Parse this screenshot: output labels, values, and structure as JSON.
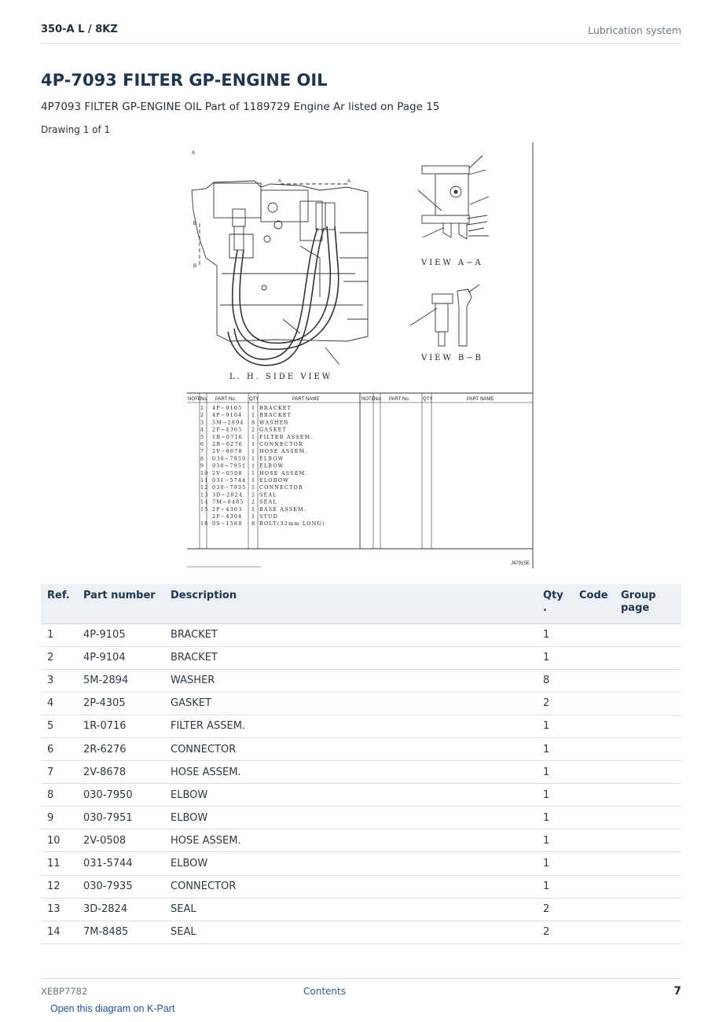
{
  "header": {
    "model": "350-A L  /  8KZ",
    "section": "Lubrication system"
  },
  "title": "4P-7093 FILTER GP-ENGINE OIL",
  "subtitle": "4P7093 FILTER GP-ENGINE OIL Part of 1189729 Engine Ar listed on Page 15",
  "drawing_count": "Drawing 1 of 1",
  "diagram": {
    "side_view_label": "L. H.   SIDE  VIEW",
    "view_a_label": "VIEW  A−A",
    "view_b_label": "VIEW  B−B",
    "marker_a": "A",
    "marker_b": "B",
    "drawing_code": "J47915E",
    "table_headers": {
      "note": "NOTE",
      "no": "No.",
      "part_no": "PART No.",
      "qty": "QTY",
      "part_name": "PART NAME"
    },
    "table_rows": [
      {
        "no": "1",
        "part": "4P−9105",
        "qty": "1",
        "name": "BRACKET"
      },
      {
        "no": "2",
        "part": "4P−9104",
        "qty": "1",
        "name": "BRACKET"
      },
      {
        "no": "3",
        "part": "5M−2894",
        "qty": "8",
        "name": "WASHER"
      },
      {
        "no": "4",
        "part": "2P−4305",
        "qty": "2",
        "name": "GASKET"
      },
      {
        "no": "5",
        "part": "1R−0716",
        "qty": "1",
        "name": "FILTER  ASSEM."
      },
      {
        "no": "6",
        "part": "2R−6276",
        "qty": "1",
        "name": "CONNECTOR"
      },
      {
        "no": "7",
        "part": "2V−8678",
        "qty": "1",
        "name": "HOSE  ASSEM."
      },
      {
        "no": "8",
        "part": "030−7950",
        "qty": "1",
        "name": "ELBOW"
      },
      {
        "no": "9",
        "part": "030−7951",
        "qty": "1",
        "name": "ELBOW"
      },
      {
        "no": "10",
        "part": "2V−0508",
        "qty": "1",
        "name": "HOSE  ASSEM."
      },
      {
        "no": "11",
        "part": "031−5744",
        "qty": "1",
        "name": "ELOBOW"
      },
      {
        "no": "12",
        "part": "030−7935",
        "qty": "1",
        "name": "CONNECTOR"
      },
      {
        "no": "13",
        "part": "3D−2824",
        "qty": "2",
        "name": "SEAL"
      },
      {
        "no": "14",
        "part": "7M−8485",
        "qty": "2",
        "name": "SEAL"
      },
      {
        "no": "15",
        "part": "2P−4303",
        "qty": "1",
        "name": "BASE  ASSEM."
      },
      {
        "no": "",
        "part": "2P−4304",
        "qty": "1",
        "name": "  STUD"
      },
      {
        "no": "16",
        "part": "0S−1588",
        "qty": "8",
        "name": "BOLT(32mm  LONG)"
      }
    ]
  },
  "table": {
    "headers": {
      "ref": "Ref.",
      "part_number": "Part number",
      "description": "Description",
      "qty": "Qty",
      "qty_dot": ".",
      "code": "Code",
      "group_page": "Group page"
    },
    "rows": [
      {
        "ref": "1",
        "part_number": "4P-9105",
        "description": "BRACKET",
        "qty": "1",
        "code": "",
        "group_page": ""
      },
      {
        "ref": "2",
        "part_number": "4P-9104",
        "description": "BRACKET",
        "qty": "1",
        "code": "",
        "group_page": ""
      },
      {
        "ref": "3",
        "part_number": "5M-2894",
        "description": "WASHER",
        "qty": "8",
        "code": "",
        "group_page": ""
      },
      {
        "ref": "4",
        "part_number": "2P-4305",
        "description": "GASKET",
        "qty": "2",
        "code": "",
        "group_page": ""
      },
      {
        "ref": "5",
        "part_number": "1R-0716",
        "description": "FILTER ASSEM.",
        "qty": "1",
        "code": "",
        "group_page": ""
      },
      {
        "ref": "6",
        "part_number": "2R-6276",
        "description": "CONNECTOR",
        "qty": "1",
        "code": "",
        "group_page": ""
      },
      {
        "ref": "7",
        "part_number": "2V-8678",
        "description": "HOSE ASSEM.",
        "qty": "1",
        "code": "",
        "group_page": ""
      },
      {
        "ref": "8",
        "part_number": "030-7950",
        "description": "ELBOW",
        "qty": "1",
        "code": "",
        "group_page": ""
      },
      {
        "ref": "9",
        "part_number": "030-7951",
        "description": "ELBOW",
        "qty": "1",
        "code": "",
        "group_page": ""
      },
      {
        "ref": "10",
        "part_number": "2V-0508",
        "description": "HOSE ASSEM.",
        "qty": "1",
        "code": "",
        "group_page": ""
      },
      {
        "ref": "11",
        "part_number": "031-5744",
        "description": "ELBOW",
        "qty": "1",
        "code": "",
        "group_page": ""
      },
      {
        "ref": "12",
        "part_number": "030-7935",
        "description": "CONNECTOR",
        "qty": "1",
        "code": "",
        "group_page": ""
      },
      {
        "ref": "13",
        "part_number": "3D-2824",
        "description": "SEAL",
        "qty": "2",
        "code": "",
        "group_page": ""
      },
      {
        "ref": "14",
        "part_number": "7M-8485",
        "description": "SEAL",
        "qty": "2",
        "code": "",
        "group_page": ""
      }
    ]
  },
  "footer": {
    "doc_id": "XEBP7782",
    "contents_link": "Contents",
    "page_number": "7"
  },
  "kpart_link": "Open this diagram on K-Part"
}
